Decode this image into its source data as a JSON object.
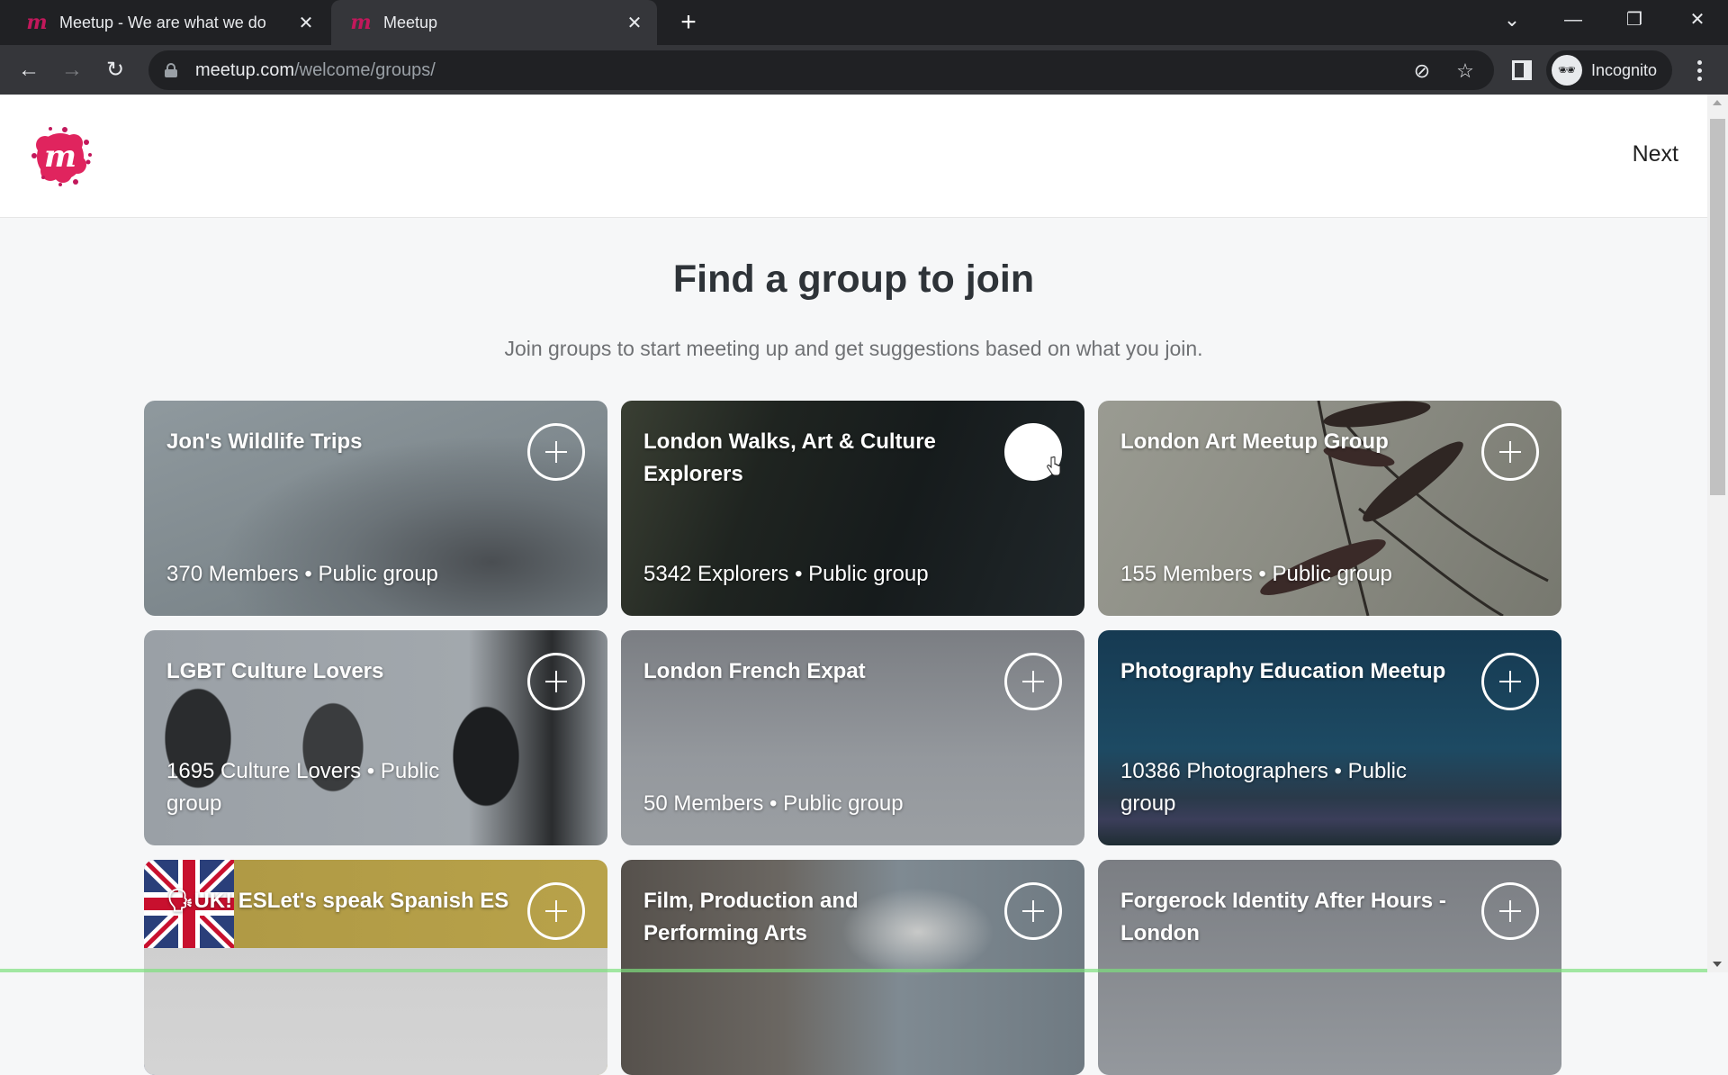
{
  "browser": {
    "tabs": [
      {
        "title": "Meetup - We are what we do",
        "active": false
      },
      {
        "title": "Meetup",
        "active": true
      }
    ],
    "new_tab_label": "+",
    "url_host": "meetup.com",
    "url_path": "/welcome/groups/",
    "profile_label": "Incognito",
    "icons": {
      "back": "←",
      "forward": "→",
      "reload": "↻",
      "close": "✕",
      "tab_search": "⌄",
      "minimize": "—",
      "restore": "❐",
      "eye_off": "⊘",
      "star": "☆",
      "incognito": "🕶"
    }
  },
  "header": {
    "logo_letter": "m",
    "next_label": "Next",
    "brand_color": "#e0245e"
  },
  "main": {
    "title": "Find a group to join",
    "subtitle": "Join groups to start meeting up and get suggestions based on what you join.",
    "groups": [
      {
        "name": "Jon's Wildlife Trips",
        "meta": "370 Members • Public group",
        "join_state": "default"
      },
      {
        "name": "London Walks, Art & Culture Explorers",
        "meta": "5342 Explorers • Public group",
        "join_state": "hovered"
      },
      {
        "name": "London Art Meetup Group",
        "meta": "155 Members • Public group",
        "join_state": "default"
      },
      {
        "name": "LGBT Culture Lovers",
        "meta": "1695 Culture Lovers • Public group",
        "join_state": "default"
      },
      {
        "name": "London French Expat",
        "meta": "50 Members • Public group",
        "join_state": "default"
      },
      {
        "name": "Photography Education Meetup",
        "meta": "10386 Photographers • Public group",
        "join_state": "default"
      },
      {
        "name": "🗣UK! ESLet's speak Spanish ES",
        "meta": "",
        "join_state": "default"
      },
      {
        "name": "Film, Production and Performing Arts",
        "meta": "",
        "join_state": "default"
      },
      {
        "name": "Forgerock Identity After Hours - London",
        "meta": "",
        "join_state": "default"
      }
    ]
  }
}
